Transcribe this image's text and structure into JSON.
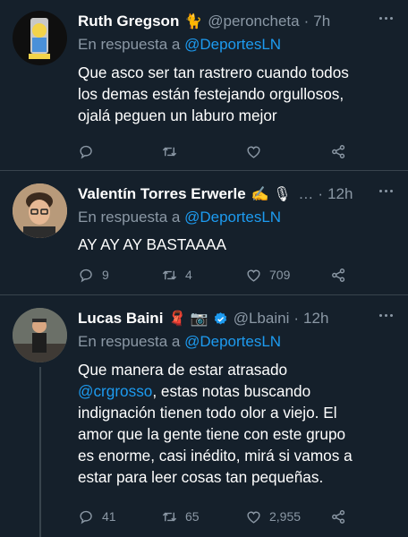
{
  "tweets": [
    {
      "name": "Ruth Gregson",
      "emoji": "🐈",
      "handle": "@peroncheta",
      "time": "7h",
      "reply_prefix": "En respuesta a",
      "reply_to": "@DeportesLN",
      "lines": [
        "Que asco ser tan rastrero cuando todos",
        "los demas están festejando orgullosos,",
        "ojalá peguen un laburo mejor"
      ],
      "replies": "",
      "retweets": "",
      "likes": ""
    },
    {
      "name": "Valentín Torres Erwerle",
      "emoji": "✍️ 🎙",
      "handle": "…",
      "time": "12h",
      "reply_prefix": "En respuesta a",
      "reply_to": "@DeportesLN",
      "lines": [
        "AY AY AY BASTAAAA"
      ],
      "replies": "9",
      "retweets": "4",
      "likes": "709"
    },
    {
      "name": "Lucas Baini",
      "emoji": "🧣 📷",
      "handle": "@Lbaini",
      "time": "12h",
      "reply_prefix": "En respuesta a",
      "reply_to": "@DeportesLN",
      "line1": "Que manera de estar atrasado",
      "mention": "@crgrosso",
      "line2_rest": ", estas notas buscando",
      "lines_rest": [
        "indignación tienen todo olor a viejo. El",
        "amor que la gente tiene con este grupo",
        "es enorme, casi inédito, mirá si vamos a",
        "estar para leer cosas tan pequeñas."
      ],
      "replies": "41",
      "retweets": "65",
      "likes": "2,955"
    }
  ],
  "separator": "·",
  "colors": {
    "background": "#15202b",
    "link": "#1d9bf0",
    "muted": "#8b98a5",
    "divider": "#38444d",
    "verified": "#1d9bf0"
  },
  "icons": [
    "reply-icon",
    "retweet-icon",
    "like-icon",
    "share-icon",
    "more-icon",
    "verified-badge-icon"
  ]
}
